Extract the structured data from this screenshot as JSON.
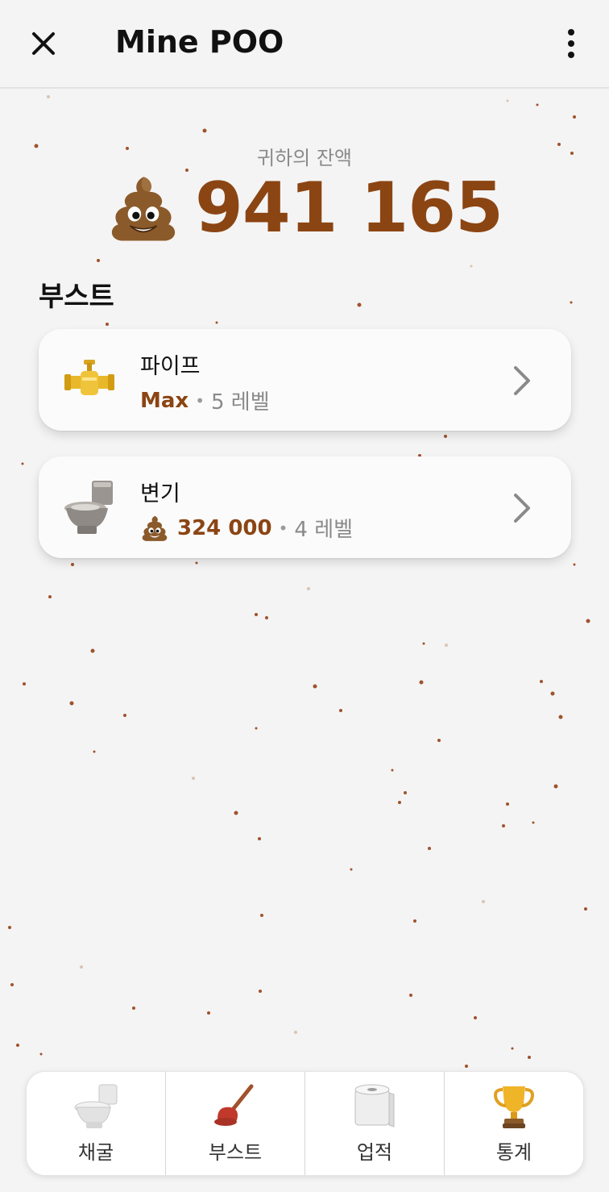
{
  "header": {
    "title": "Mine POO",
    "close_icon": "close-icon",
    "menu_icon": "more-vertical-icon"
  },
  "balance": {
    "label": "귀하의 잔액",
    "value": "941 165",
    "icon": "poo-icon"
  },
  "boosts": {
    "title": "부스트",
    "items": [
      {
        "name": "파이프",
        "icon": "pipe-icon",
        "price": "Max",
        "price_has_poo": false,
        "separator": "•",
        "level": "5 레벨"
      },
      {
        "name": "변기",
        "icon": "toilet-icon",
        "price": "324 000",
        "price_has_poo": true,
        "separator": "•",
        "level": "4 레벨"
      }
    ]
  },
  "nav": {
    "items": [
      {
        "label": "채굴",
        "icon": "toilet-icon"
      },
      {
        "label": "부스트",
        "icon": "plunger-icon"
      },
      {
        "label": "업적",
        "icon": "toilet-paper-icon"
      },
      {
        "label": "통계",
        "icon": "trophy-icon"
      }
    ]
  },
  "colors": {
    "accent": "#8b4513",
    "background": "#f4f4f4",
    "muted": "#8a8a8a"
  }
}
